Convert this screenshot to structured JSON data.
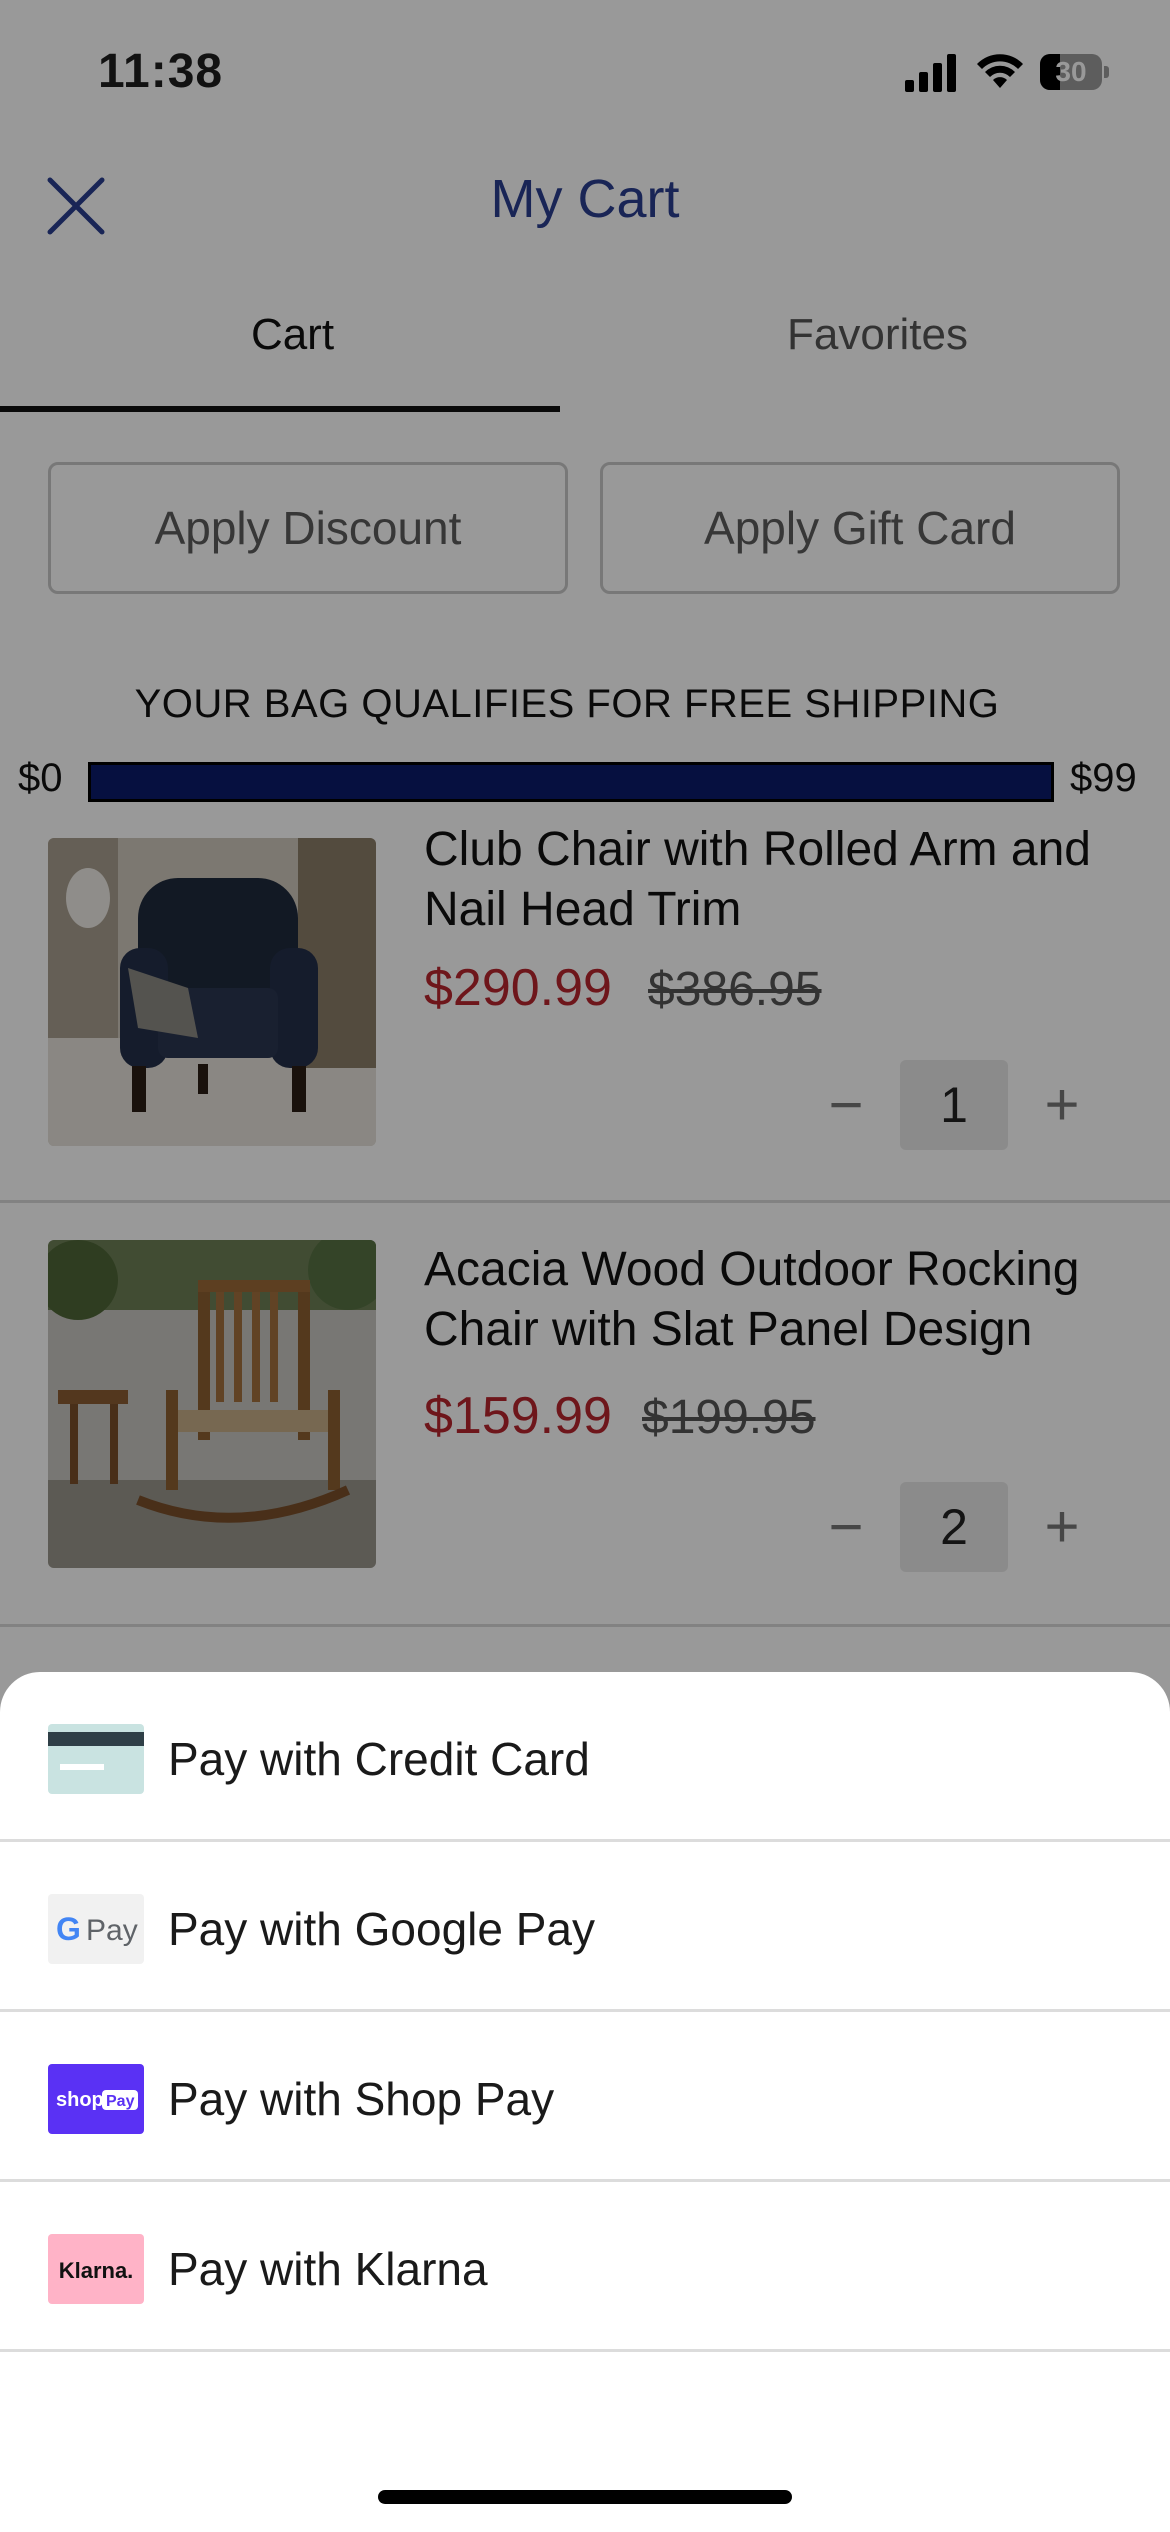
{
  "status_bar": {
    "time": "11:38",
    "battery": "30"
  },
  "header": {
    "title": "My Cart",
    "close_icon": "close-icon"
  },
  "tabs": [
    {
      "label": "Cart",
      "active": true
    },
    {
      "label": "Favorites",
      "active": false
    }
  ],
  "actions": {
    "discount_label": "Apply Discount",
    "gift_card_label": "Apply Gift Card"
  },
  "shipping": {
    "message": "YOUR BAG QUALIFIES FOR FREE SHIPPING",
    "min_label": "$0",
    "max_label": "$99",
    "progress": 1.0
  },
  "items": [
    {
      "name": "Club Chair with Rolled Arm and Nail Head Trim",
      "sale_price": "$290.99",
      "original_price": "$386.95",
      "quantity": "1"
    },
    {
      "name": "Acacia Wood Outdoor Rocking Chair with Slat Panel Design",
      "sale_price": "$159.99",
      "original_price": "$199.95",
      "quantity": "2"
    }
  ],
  "qty_controls": {
    "minus": "−",
    "plus": "+"
  },
  "payment_options": [
    {
      "label": "Pay with Credit Card",
      "icon": "credit-card-icon"
    },
    {
      "label": "Pay with Google Pay",
      "icon": "google-pay-logo",
      "logo_text": "G Pay"
    },
    {
      "label": "Pay with Shop Pay",
      "icon": "shop-pay-logo",
      "logo_text": "shop Pay"
    },
    {
      "label": "Pay with Klarna",
      "icon": "klarna-logo",
      "logo_text": "Klarna."
    }
  ],
  "colors": {
    "title_blue": "#2a3f8f",
    "progress_fill": "#0a1c6b",
    "sale_red": "#b8262e",
    "shop_pay_purple": "#5a31f4",
    "klarna_pink": "#ffb3c7"
  }
}
